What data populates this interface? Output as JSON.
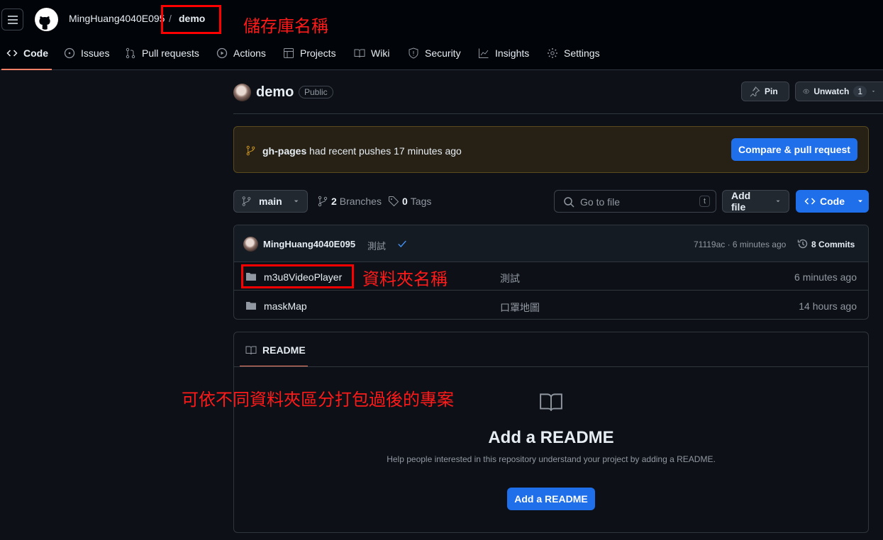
{
  "header": {
    "owner": "MingHuang4040E095",
    "separator": "/",
    "repo": "demo"
  },
  "annotations": {
    "repo_name_note": "儲存庫名稱",
    "folder_name_note": "資料夾名稱",
    "folders_note": "可依不同資料夾區分打包過後的專案",
    "color": "#ff0000"
  },
  "nav": {
    "tabs": [
      {
        "label": "Code",
        "icon": "code-icon",
        "active": true
      },
      {
        "label": "Issues",
        "icon": "issue-icon"
      },
      {
        "label": "Pull requests",
        "icon": "pull-request-icon"
      },
      {
        "label": "Actions",
        "icon": "play-icon"
      },
      {
        "label": "Projects",
        "icon": "table-icon"
      },
      {
        "label": "Wiki",
        "icon": "book-icon"
      },
      {
        "label": "Security",
        "icon": "shield-icon"
      },
      {
        "label": "Insights",
        "icon": "graph-icon"
      },
      {
        "label": "Settings",
        "icon": "gear-icon"
      }
    ],
    "accent": "#f78166"
  },
  "repo_head": {
    "name": "demo",
    "visibility": "Public",
    "pin_label": "Pin",
    "unwatch_label": "Unwatch",
    "watch_count": "1"
  },
  "banner": {
    "branch": "gh-pages",
    "message": "had recent pushes 17 minutes ago",
    "button": "Compare & pull request"
  },
  "toolbar": {
    "branch": "main",
    "branches_count": "2",
    "branches_label": "Branches",
    "tags_count": "0",
    "tags_label": "Tags",
    "search_placeholder": "Go to file",
    "search_shortcut": "t",
    "add_file": "Add file",
    "code_button": "Code"
  },
  "latest_commit": {
    "author": "MingHuang4040E095",
    "message": "測試",
    "hash_time": "71119ac · 6 minutes ago",
    "commits_label": "8 Commits"
  },
  "files": [
    {
      "name": "m3u8VideoPlayer",
      "message": "測試",
      "time": "6 minutes ago"
    },
    {
      "name": "maskMap",
      "message": "口罩地圖",
      "time": "14 hours ago"
    }
  ],
  "readme": {
    "tab_label": "README",
    "title": "Add a README",
    "description": "Help people interested in this repository understand your project by adding a README.",
    "button": "Add a README"
  }
}
